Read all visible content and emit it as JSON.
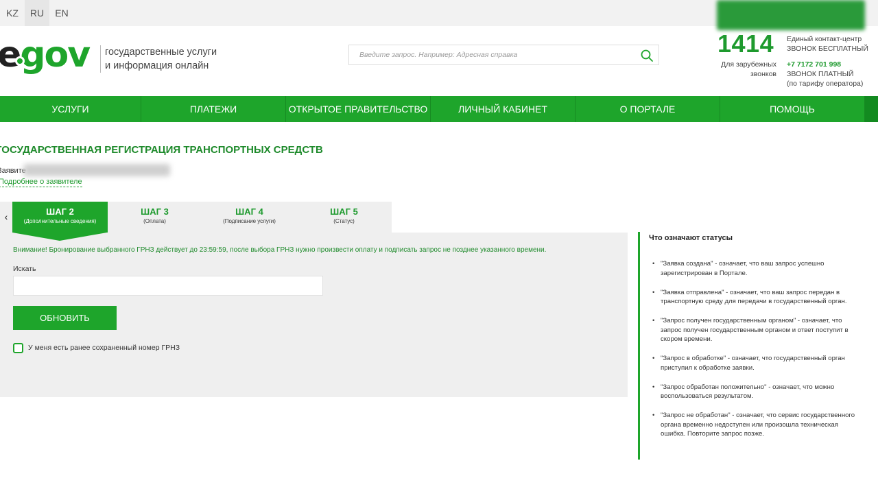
{
  "languages": [
    "KZ",
    "RU",
    "EN"
  ],
  "active_language": "RU",
  "logo": {
    "e": "e",
    "gov": "gov"
  },
  "tagline": {
    "line1": "государственные услуги",
    "line2": "и информация онлайн"
  },
  "search": {
    "placeholder": "Введите запрос. Например: Адресная справка"
  },
  "contact": {
    "short_number": "1414",
    "center_label": "Единый контакт-центр",
    "free_call": "ЗВОНОК БЕСПЛАТНЫЙ",
    "foreign_label_1": "Для зарубежных",
    "foreign_label_2": "звонков",
    "foreign_number": "+7 7172 701 998",
    "paid_call": "ЗВОНОК ПЛАТНЫЙ",
    "tariff": "(по тарифу оператора)"
  },
  "nav": [
    "УСЛУГИ",
    "ПЛАТЕЖИ",
    "ОТКРЫТОЕ ПРАВИТЕЛЬСТВО",
    "ЛИЧНЫЙ КАБИНЕТ",
    "О ПОРТАЛЕ",
    "ПОМОЩЬ"
  ],
  "page": {
    "title": "ГОСУДАРСТВЕННАЯ РЕГИСТРАЦИЯ ТРАНСПОРТНЫХ СРЕДСТВ",
    "applicant_label": "Заявите",
    "more_link": "Подробнее о заявителе"
  },
  "steps": {
    "prev_symbol": "‹",
    "items": [
      {
        "title": "ШАГ 2",
        "subtitle": "(Дополнительные сведения)",
        "active": true
      },
      {
        "title": "ШАГ 3",
        "subtitle": "(Оплата)",
        "active": false
      },
      {
        "title": "ШАГ 4",
        "subtitle": "(Подписание услуги)",
        "active": false
      },
      {
        "title": "ШАГ 5",
        "subtitle": "(Статус)",
        "active": false
      }
    ]
  },
  "form": {
    "notice": "Внимание! Бронирование выбранного ГРНЗ действует до 23:59:59, после выбора ГРНЗ нужно произвести оплату и подписать запрос не позднее указанного времени.",
    "search_label": "Искать",
    "search_value": "",
    "update_button": "ОБНОВИТЬ",
    "checkbox_label": "У меня есть ранее сохраненный номер ГРНЗ",
    "checkbox_checked": false
  },
  "statuses": {
    "title": "Что означают статусы",
    "items": [
      "\"Заявка создана\" - означает, что ваш запрос успешно зарегистрирован в Портале.",
      "\"Заявка отправлена\" - означает, что ваш запрос передан в транспортную среду для передачи в государственный орган.",
      "\"Запрос получен государственным органом\" - означает, что запрос получен государственным органом и ответ поступит в скором времени.",
      "\"Запрос в обработке\" - означает, что государственный орган приступил к обработке заявки.",
      "\"Запрос обработан положительно\" - означает, что можно воспользоваться результатом.",
      "\"Запрос не обработан\" - означает, что сервис государственного органа временно недоступен или произошла техническая ошибка. Повторите запрос позже."
    ]
  },
  "colors": {
    "brand_green": "#1ea52b",
    "dark_green": "#1e8a2b",
    "panel_gray": "#efefef"
  }
}
